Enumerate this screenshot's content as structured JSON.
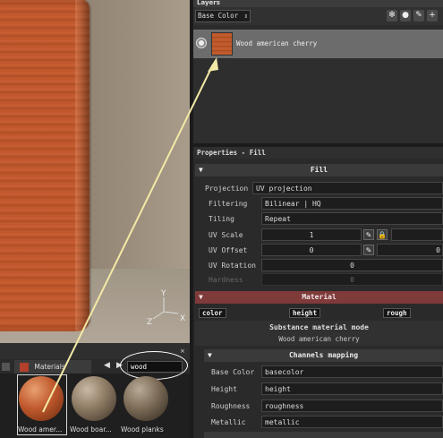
{
  "layers": {
    "title": "Layers",
    "channel_select": "Base Color",
    "toolbar_icons": [
      "particles-icon",
      "circle-icon",
      "brush-icon",
      "add-icon"
    ],
    "layer_name": "Wood american cherry"
  },
  "properties": {
    "title": "Properties - Fill",
    "fill_section": "Fill",
    "projection_label": "Projection",
    "projection_value": "UV projection",
    "filtering_label": "Filtering",
    "filtering_value": "Bilinear | HQ",
    "tiling_label": "Tiling",
    "tiling_value": "Repeat",
    "uv_scale_label": "UV Scale",
    "uv_scale_value": "1",
    "uv_offset_label": "UV Offset",
    "uv_offset_value": "0",
    "uv_offset_value2": "0",
    "uv_rotation_label": "UV Rotation",
    "uv_rotation_value": "0",
    "hardness_label": "Hardness",
    "hardness_value": "0",
    "material_section": "Material",
    "material_chips": [
      "color",
      "height",
      "rough"
    ],
    "substance_mode_label": "Substance material mode",
    "substance_mode_value": "Wood american cherry",
    "channels_section": "Channels mapping",
    "mappings": [
      {
        "label": "Base Color",
        "value": "basecolor"
      },
      {
        "label": "Height",
        "value": "height"
      },
      {
        "label": "Roughness",
        "value": "roughness"
      },
      {
        "label": "Metallic",
        "value": "metallic"
      }
    ]
  },
  "viewport": {
    "gizmo_axes": [
      "Y",
      "Z",
      "X"
    ]
  },
  "shelf": {
    "tab_label": "Materials",
    "search_value": "wood",
    "items": [
      {
        "label": "Wood amer..."
      },
      {
        "label": "Wood boar..."
      },
      {
        "label": "Wood planks"
      }
    ]
  },
  "colors": {
    "material_bar": "#7f3a3a",
    "selected_layer": "#6c6c6c",
    "arrow": "#f3e9a6"
  }
}
